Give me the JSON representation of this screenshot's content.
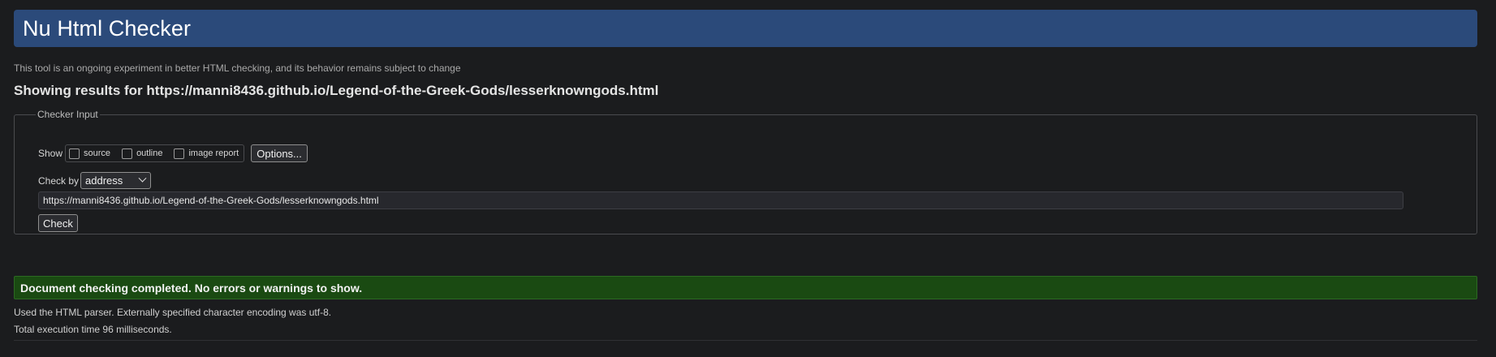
{
  "header": {
    "title": "Nu Html Checker"
  },
  "tagline": "This tool is an ongoing experiment in better HTML checking, and its behavior remains subject to change",
  "results": {
    "prefix": "Showing results for ",
    "url": "https://manni8436.github.io/Legend-of-the-Greek-Gods/lesserknowngods.html"
  },
  "checker_input": {
    "legend": "Checker Input",
    "show_label": "Show",
    "show_options": [
      {
        "label": "source",
        "checked": false
      },
      {
        "label": "outline",
        "checked": false
      },
      {
        "label": "image report",
        "checked": false
      }
    ],
    "options_button": "Options...",
    "check_by_label": "Check by",
    "check_by_value": "address",
    "address_value": "https://manni8436.github.io/Legend-of-the-Greek-Gods/lesserknowngods.html",
    "check_button": "Check"
  },
  "status": {
    "message": "Document checking completed. No errors or warnings to show.",
    "color": "#1a4a12"
  },
  "info": {
    "parser_line": "Used the HTML parser. Externally specified character encoding was utf-8.",
    "time_line": "Total execution time 96 milliseconds."
  },
  "colors": {
    "header_bg": "#2b4a7a",
    "page_bg": "#1b1c1e"
  }
}
